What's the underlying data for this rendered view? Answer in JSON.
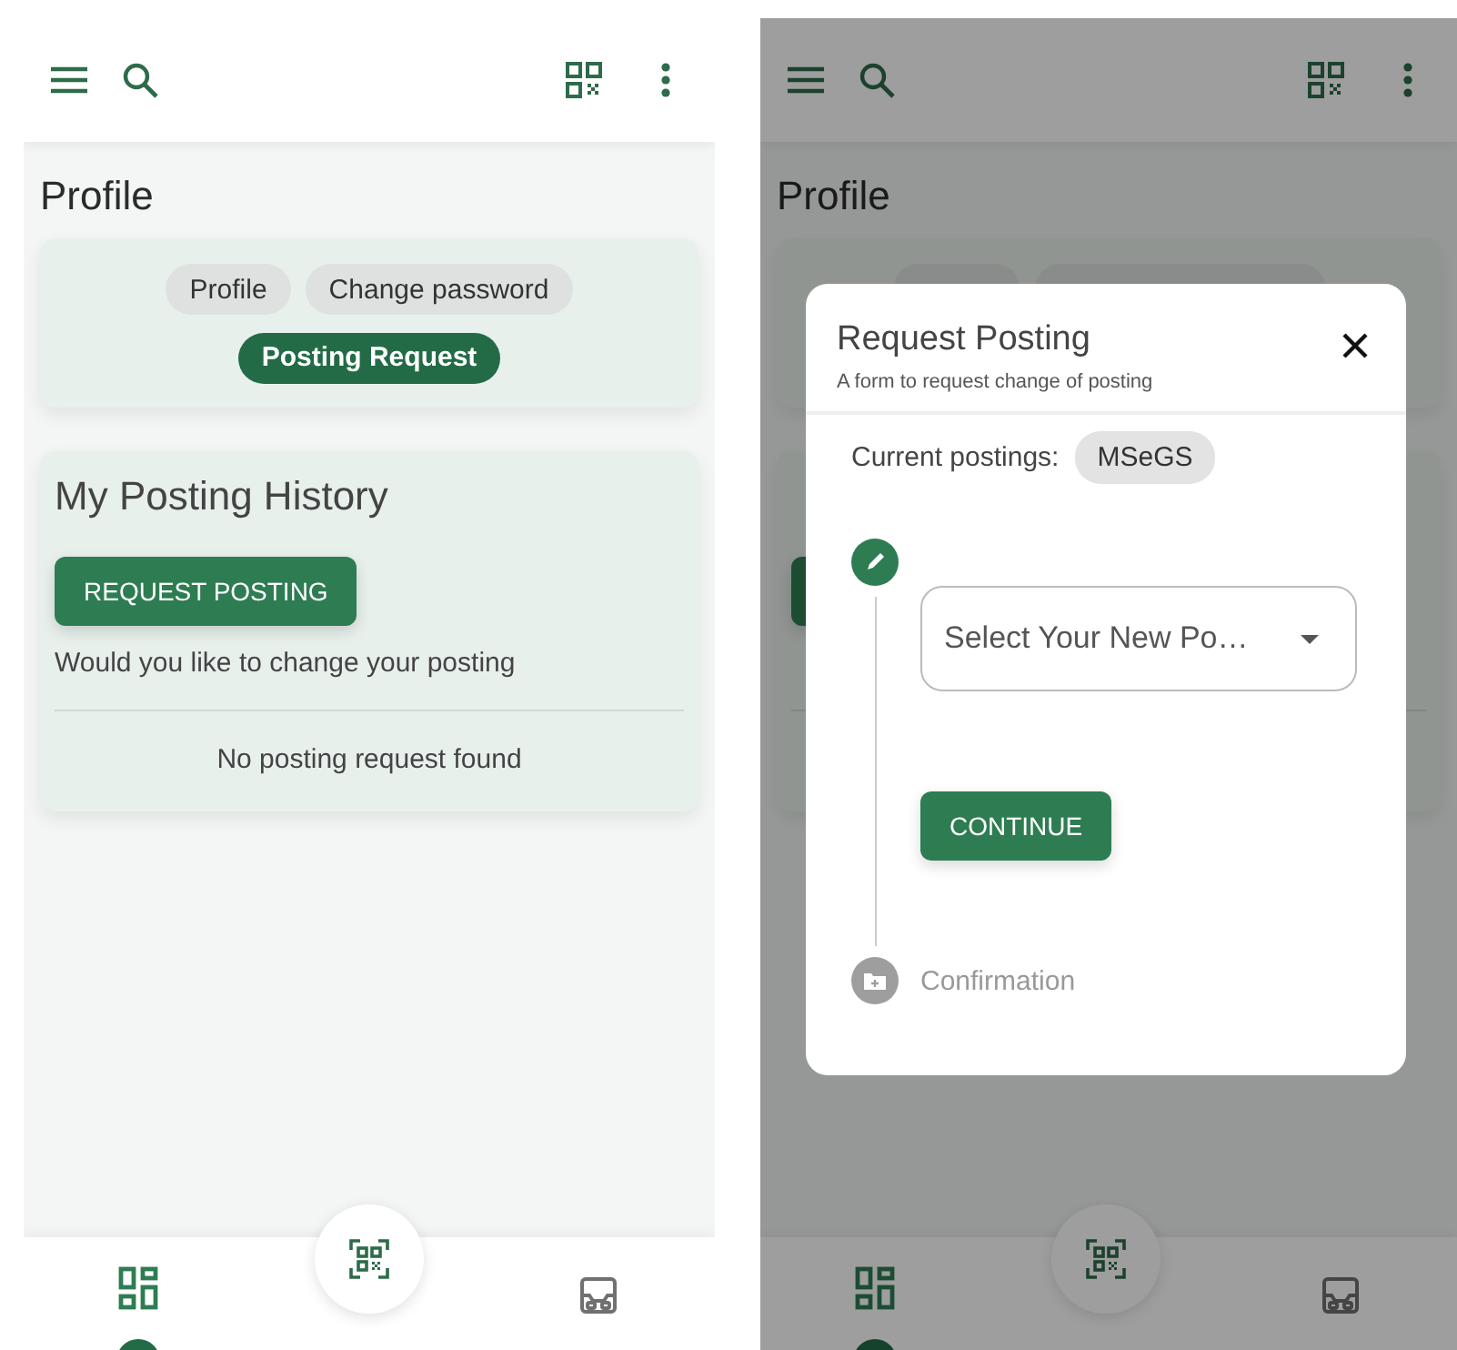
{
  "profile_screen": {
    "title": "Profile",
    "tabs": [
      {
        "label": "Profile",
        "selected": false
      },
      {
        "label": "Change password",
        "selected": false
      },
      {
        "label": "Posting Request",
        "selected": true
      }
    ],
    "history": {
      "title": "My Posting History",
      "button": "REQUEST POSTING",
      "prompt": "Would you like to change your posting",
      "empty": "No posting request found"
    },
    "bottom_nav": [
      {
        "selected": true
      },
      {
        "selected": false
      }
    ]
  },
  "dialog_screen": {
    "backdrop": {
      "title": "Profile"
    },
    "dialog": {
      "title": "Request Posting",
      "subtitle": "A form to request change of posting",
      "current_label": "Current postings:",
      "current_postings": [
        "MSeGS"
      ],
      "steps": [
        {
          "kind": "form",
          "active": true,
          "placeholder": "Select Your New Po…",
          "button": "CONTINUE"
        },
        {
          "kind": "label",
          "active": false,
          "label": "Confirmation"
        }
      ]
    },
    "bottom_nav": [
      {
        "selected": true
      },
      {
        "selected": false
      }
    ]
  }
}
